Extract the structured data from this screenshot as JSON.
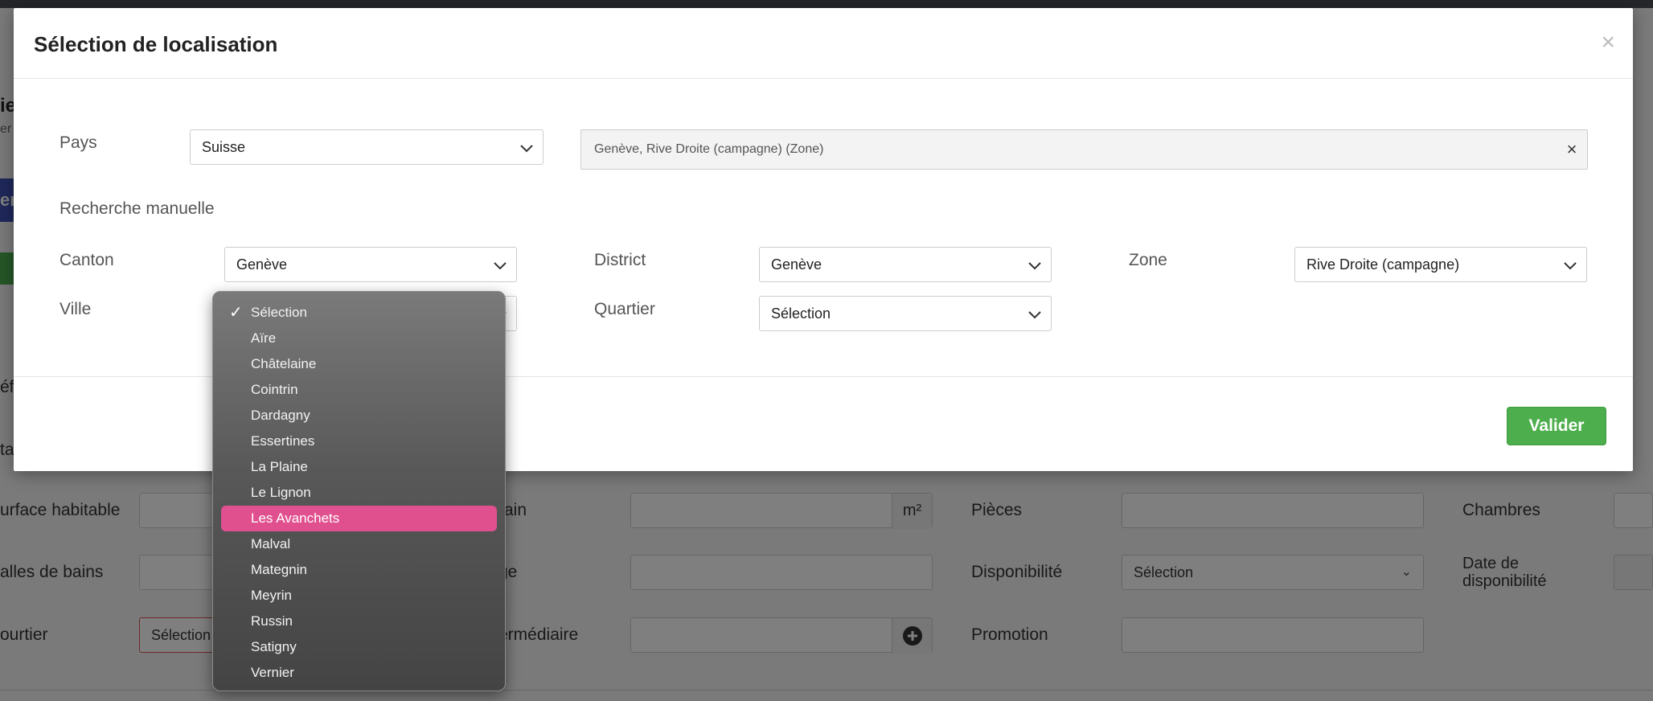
{
  "background": {
    "title_fragment": "ie",
    "subtitle_fragment": "er",
    "blue_button_fragment": "en",
    "row1": {
      "surface_label": "urface habitable",
      "terrain_label": "rain",
      "terrain_unit": "m²",
      "pieces_label": "Pièces",
      "chambres_label": "Chambres"
    },
    "row2": {
      "salles_label": "alles de bains",
      "etage_label": "ge",
      "disponibilite_label": "Disponibilité",
      "disponibilite_value": "Sélection",
      "date_label": "Date de disponibilité"
    },
    "row3": {
      "courtier_label": "ourtier",
      "courtier_value": "Sélection",
      "intermediaire_label": "ermédiaire",
      "promotion_label": "Promotion"
    },
    "left_fragment_1": "éf",
    "left_fragment_2": "ta"
  },
  "modal": {
    "title": "Sélection de localisation",
    "close_icon": "×",
    "pays": {
      "label": "Pays",
      "value": "Suisse"
    },
    "location_summary": "Genève, Rive Droite (campagne) (Zone)",
    "location_clear": "×",
    "manual_search_label": "Recherche manuelle",
    "canton": {
      "label": "Canton",
      "value": "Genève"
    },
    "district": {
      "label": "District",
      "value": "Genève"
    },
    "zone": {
      "label": "Zone",
      "value": "Rive Droite (campagne)"
    },
    "ville": {
      "label": "Ville"
    },
    "quartier": {
      "label": "Quartier",
      "value": "Sélection"
    },
    "submit_label": "Valider"
  },
  "dropdown": {
    "checked_index": 0,
    "highlighted_index": 8,
    "check_glyph": "✓",
    "options": [
      "Sélection",
      "Aïre",
      "Châtelaine",
      "Cointrin",
      "Dardagny",
      "Essertines",
      "La Plaine",
      "Le Lignon",
      "Les Avanchets",
      "Malval",
      "Mategnin",
      "Meyrin",
      "Russin",
      "Satigny",
      "Vernier"
    ]
  },
  "colors": {
    "accent_highlight": "#e0508f",
    "submit_green": "#4cae4c"
  }
}
